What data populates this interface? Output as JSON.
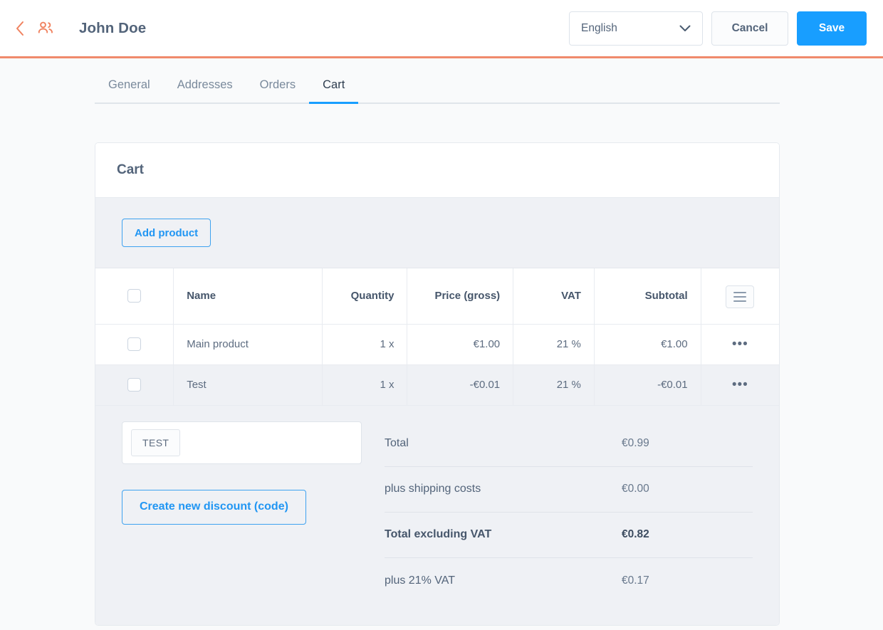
{
  "header": {
    "back_icon": "chevron-left-icon",
    "entity_icon": "users-icon",
    "title": "John Doe",
    "language_value": "English",
    "cancel_label": "Cancel",
    "save_label": "Save",
    "accent_color": "#f08a6c",
    "primary_color": "#189eff"
  },
  "tabs": [
    {
      "label": "General",
      "active": false
    },
    {
      "label": "Addresses",
      "active": false
    },
    {
      "label": "Orders",
      "active": false
    },
    {
      "label": "Cart",
      "active": true
    }
  ],
  "card": {
    "title": "Cart",
    "add_product_label": "Add product",
    "columns_menu_icon": "hamburger-icon"
  },
  "table": {
    "headers": [
      "",
      "Name",
      "Quantity",
      "Price (gross)",
      "VAT",
      "Subtotal",
      ""
    ],
    "rows": [
      {
        "name": "Main product",
        "quantity": "1 x",
        "price": "€1.00",
        "vat": "21 %",
        "subtotal": "€1.00",
        "actions_icon": "ellipsis-icon"
      },
      {
        "name": "Test",
        "quantity": "1 x",
        "price": "-€0.01",
        "vat": "21 %",
        "subtotal": "-€0.01",
        "actions_icon": "ellipsis-icon"
      }
    ]
  },
  "discount": {
    "chip_label": "TEST",
    "input_placeholder": "",
    "create_label": "Create new discount (code)"
  },
  "totals": [
    {
      "label": "Total",
      "value": "€0.99",
      "strong": false
    },
    {
      "label": "plus shipping costs",
      "value": "€0.00",
      "strong": false
    },
    {
      "label": "Total excluding VAT",
      "value": "€0.82",
      "strong": true
    },
    {
      "label": "plus 21% VAT",
      "value": "€0.17",
      "strong": false
    }
  ]
}
